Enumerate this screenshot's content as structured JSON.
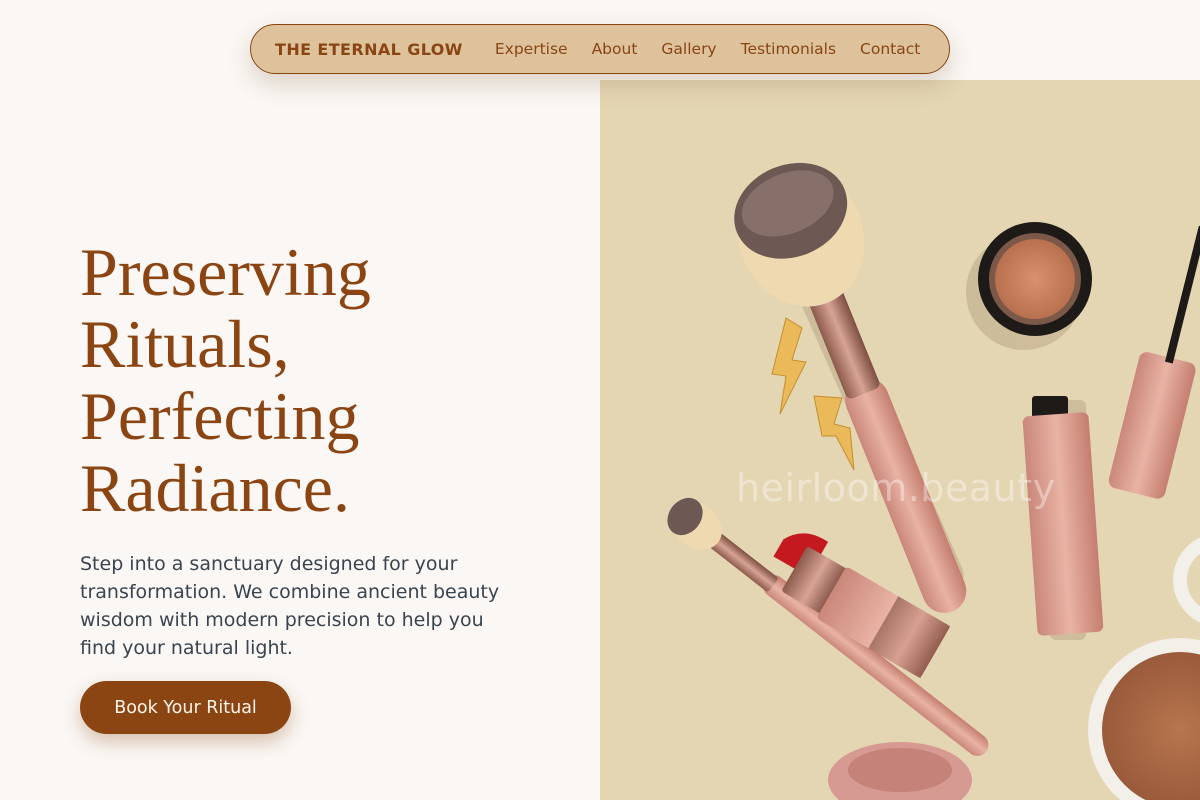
{
  "nav": {
    "brand": "THE ETERNAL GLOW",
    "links": [
      "Expertise",
      "About",
      "Gallery",
      "Testimonials",
      "Contact"
    ]
  },
  "hero": {
    "title_lines": [
      "Preserving",
      "Rituals,",
      "Perfecting",
      "Radiance."
    ],
    "subtitle": "Step into a sanctuary designed for your transformation. We combine ancient beauty wisdom with modern precision to help you find your natural light.",
    "cta_label": "Book Your Ritual"
  },
  "image": {
    "watermark": "heirloom.beauty"
  },
  "colors": {
    "accent": "#8b4513",
    "nav_bg": "#ddc29c",
    "page_bg": "#faf7f4",
    "image_bg": "#e4d5b3",
    "body_text": "#3a4450"
  }
}
